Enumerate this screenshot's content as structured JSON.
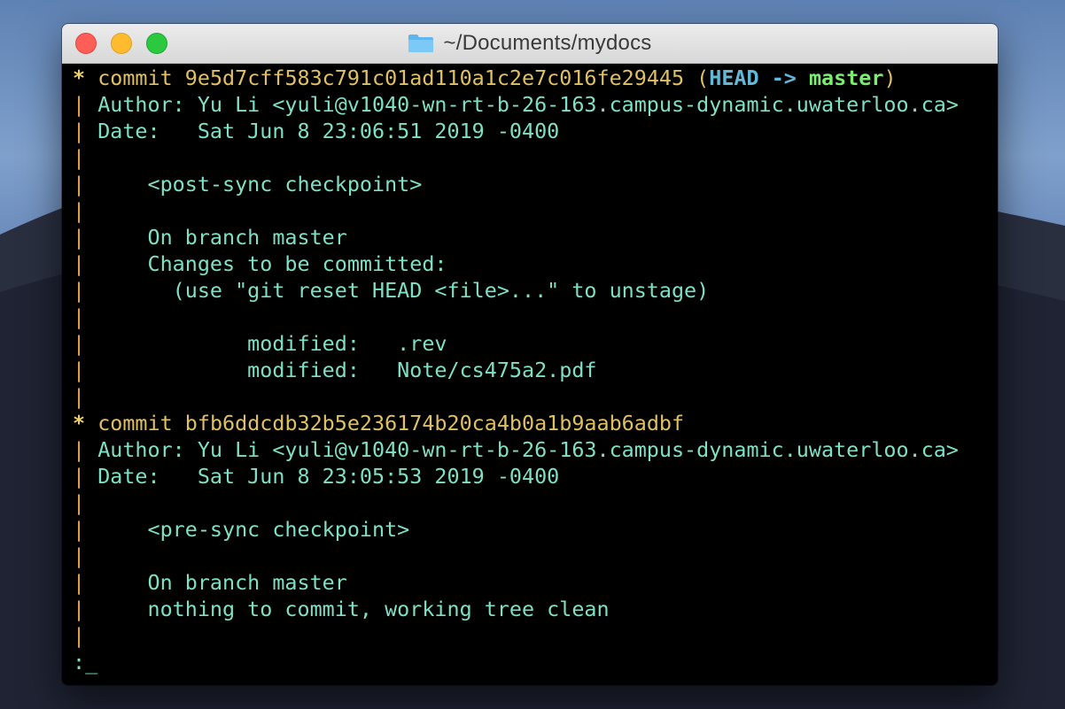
{
  "window": {
    "title": "~/Documents/mydocs",
    "folder_icon": "folder-icon",
    "buttons": {
      "close": "close-button",
      "minimize": "minimize-button",
      "zoom": "zoom-button"
    }
  },
  "colors": {
    "text": "#7ee0c4",
    "graph_star": "#f0d064",
    "graph_bar": "#e8a04a",
    "commit_hash": "#e0c062",
    "head": "#62b8d8",
    "branch": "#7aee6e",
    "background": "#000000"
  },
  "commits": [
    {
      "star": "*",
      "commit_word": "commit",
      "hash": "9e5d7cff583c791c01ad110a1c2e7c016fe29445",
      "deco_open": "(",
      "head": "HEAD",
      "arrow": "->",
      "branch": "master",
      "deco_close": ")",
      "author": "Author: Yu Li <yuli@v1040-wn-rt-b-26-163.campus-dynamic.uwaterloo.ca>",
      "date": "Date:   Sat Jun 8 23:06:51 2019 -0400",
      "message": [
        "",
        "    <post-sync checkpoint>",
        "",
        "    On branch master",
        "    Changes to be committed:",
        "      (use \"git reset HEAD <file>...\" to unstage)",
        "",
        "            modified:   .rev",
        "            modified:   Note/cs475a2.pdf",
        ""
      ]
    },
    {
      "star": "*",
      "commit_word": "commit",
      "hash": "bfb6ddcdb32b5e236174b20ca4b0a1b9aab6adbf",
      "author": "Author: Yu Li <yuli@v1040-wn-rt-b-26-163.campus-dynamic.uwaterloo.ca>",
      "date": "Date:   Sat Jun 8 23:05:53 2019 -0400",
      "message": [
        "",
        "    <pre-sync checkpoint>",
        "",
        "    On branch master",
        "    nothing to commit, working tree clean",
        ""
      ]
    }
  ],
  "graph_bar": "|",
  "prompt": ":",
  "cursor": "_"
}
